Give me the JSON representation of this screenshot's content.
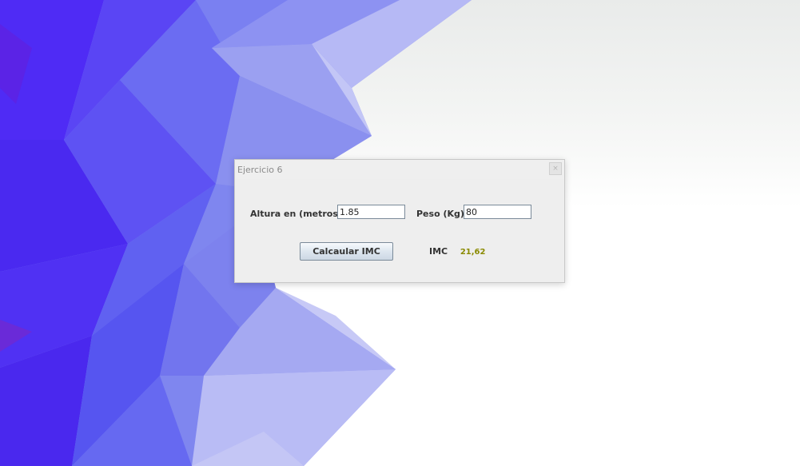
{
  "window": {
    "title": "Ejercicio 6",
    "close_glyph": "×"
  },
  "form": {
    "height_label": "Altura en (metros)",
    "height_value": "1.85",
    "weight_label": "Peso (Kg)",
    "weight_value": "80",
    "calculate_button_label": "Calcaular IMC",
    "result_label": "IMC",
    "result_value": "21,62"
  },
  "colors": {
    "result_value": "#8a8a00",
    "wallpaper_base": "#4a2bf2",
    "dialog_background": "#eeeeee"
  }
}
